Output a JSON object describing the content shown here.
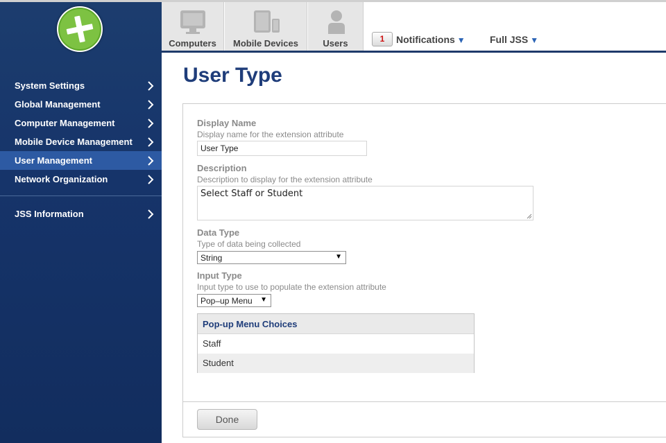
{
  "sidebar": {
    "items": [
      {
        "label": "System Settings"
      },
      {
        "label": "Global Management"
      },
      {
        "label": "Computer Management"
      },
      {
        "label": "Mobile Device Management"
      },
      {
        "label": "User Management",
        "active": true
      },
      {
        "label": "Network Organization"
      },
      {
        "label": "JSS Information"
      }
    ]
  },
  "topbar": {
    "tabs": [
      {
        "label": "Computers",
        "icon": "computer-icon"
      },
      {
        "label": "Mobile Devices",
        "icon": "mobile-devices-icon"
      },
      {
        "label": "Users",
        "icon": "user-icon"
      }
    ],
    "notifications": {
      "count": "1",
      "label": "Notifications"
    },
    "full_jss": {
      "label": "Full JSS"
    }
  },
  "page": {
    "title": "User Type"
  },
  "form": {
    "display_name": {
      "label": "Display Name",
      "help": "Display name for the extension attribute",
      "value": "User Type"
    },
    "description": {
      "label": "Description",
      "help": "Description to display for the extension attribute",
      "value": "Select Staff or Student"
    },
    "data_type": {
      "label": "Data Type",
      "help": "Type of data being collected",
      "value": "String"
    },
    "input_type": {
      "label": "Input Type",
      "help": "Input type to use to populate the extension attribute",
      "value": "Pop–up Menu"
    },
    "choices": {
      "header": "Pop-up Menu Choices",
      "items": [
        "Staff",
        "Student"
      ]
    }
  },
  "footer": {
    "done_label": "Done"
  },
  "colors": {
    "sidebar_bg": "#16346a",
    "sidebar_active": "#2d5aa3",
    "title": "#1f3d7a",
    "notification_count": "#cc1111",
    "logo_green": "#7dc242"
  }
}
